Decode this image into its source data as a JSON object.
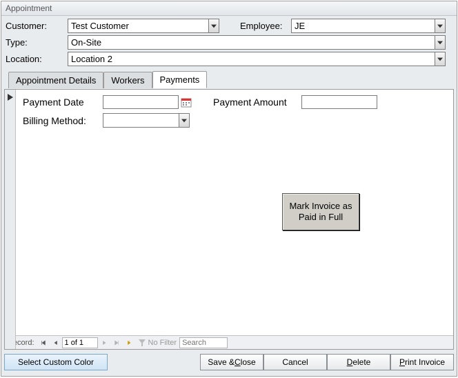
{
  "window_title": "Appointment",
  "form": {
    "customer_label": "Customer:",
    "customer_value": "Test Customer",
    "employee_label": "Employee:",
    "employee_value": "JE",
    "type_label": "Type:",
    "type_value": "On-Site",
    "location_label": "Location:",
    "location_value": "Location 2"
  },
  "tabs": {
    "details": "Appointment Details",
    "workers": "Workers",
    "payments": "Payments"
  },
  "payments": {
    "payment_date_label": "Payment Date",
    "payment_date_value": "",
    "payment_amount_label": "Payment Amount",
    "payment_amount_value": "",
    "billing_method_label": "Billing Method:",
    "billing_method_value": "",
    "mark_paid_line1": "Mark Invoice as",
    "mark_paid_line2": "Paid in Full"
  },
  "record_nav": {
    "label": "Record:",
    "position": "1 of 1",
    "no_filter": "No Filter",
    "search_placeholder": "Search"
  },
  "buttons": {
    "select_color": "Select Custom Color",
    "save_close_pre": "Save & ",
    "save_close_ul": "C",
    "save_close_post": "lose",
    "cancel": "Cancel",
    "delete_ul": "D",
    "delete_post": "elete",
    "print_ul": "P",
    "print_post": "rint Invoice"
  }
}
